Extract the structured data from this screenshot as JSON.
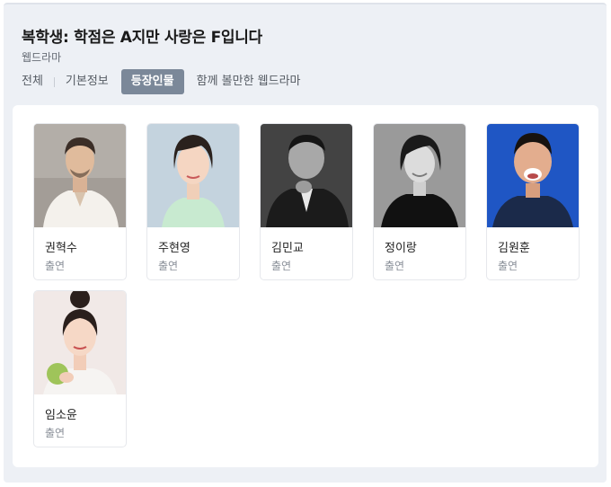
{
  "header": {
    "title": "복학생: 학점은 A지만 사랑은 F입니다",
    "subtitle": "웹드라마"
  },
  "tabs": [
    {
      "label": "전체",
      "active": false
    },
    {
      "label": "기본정보",
      "active": false
    },
    {
      "label": "등장인물",
      "active": true
    },
    {
      "label": "함께 볼만한 웹드라마",
      "active": false
    }
  ],
  "colors": {
    "active_tab": "#7b8899",
    "panel_bg": "#edf0f5",
    "role_text": "#8a9099"
  },
  "cast": [
    {
      "name": "권혁수",
      "role": "출연"
    },
    {
      "name": "주현영",
      "role": "출연"
    },
    {
      "name": "김민교",
      "role": "출연"
    },
    {
      "name": "정이랑",
      "role": "출연"
    },
    {
      "name": "김원훈",
      "role": "출연"
    },
    {
      "name": "임소윤",
      "role": "출연"
    }
  ]
}
